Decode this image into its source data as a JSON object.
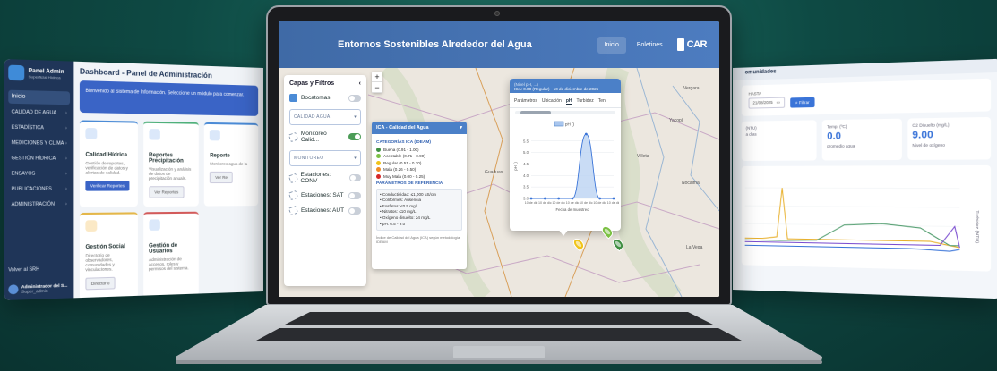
{
  "left_panel": {
    "brand_title": "Panel Admin",
    "brand_sub": "Superficial Hídrica",
    "nav_active": "Inicio",
    "nav_items": [
      "CALIDAD DE AGUA",
      "ESTADÍSTICA",
      "MEDICIONES Y CLIMA",
      "GESTIÓN HÍDRICA",
      "ENSAYOS",
      "PUBLICACIONES",
      "ADMINISTRACIÓN"
    ],
    "back_label": "Volver al SRH",
    "user_name": "Administrador del S...",
    "user_role": "Super_admin",
    "title": "Dashboard - Panel de Administración",
    "welcome": "Bienvenido al Sistema de Información. Seleccione un módulo para comenzar.",
    "cards": [
      {
        "title": "Calidad Hídrica",
        "desc": "Gestión de reportes, verificación de datos y alertas de calidad.",
        "button": "Verificar Reportes"
      },
      {
        "title": "Reportes Precipitación",
        "desc": "Visualización y análisis de datos de precipitación anuals.",
        "button": "Ver Reportes"
      },
      {
        "title": "Reporte",
        "desc": "Monitoreo agua de la",
        "button": "Ver Re"
      },
      {
        "title": "Gestión Social",
        "desc": "Directorio de observadores, comunidades y vinculaciones.",
        "button": "Directorio"
      },
      {
        "title": "Gestión de Usuarios",
        "desc": "Administración de accesos, roles y permisos del sistema.",
        "button": ""
      }
    ]
  },
  "laptop": {
    "app_title": "Entornos Sostenibles Alrededor del Agua",
    "nav": [
      "Inicio",
      "Boletines"
    ],
    "logo_text": "CAR",
    "layers": {
      "title": "Capas y Filtros",
      "bocatomas": "Bocatomas",
      "group_calidad": "CALIDAD AGUA",
      "monitoreo": "Monitoreo Calid...",
      "group_monitoreo": "MONITOREO",
      "est_conv": "Estaciones: CONV",
      "est_sat": "Estaciones: SAT",
      "est_aut": "Estaciones: AUT"
    },
    "ica": {
      "title": "ICA - Calidad del Agua",
      "cat_title": "CATEGORÍAS ICA (IDEAM)",
      "categories": [
        {
          "label": "Buena (0.91 - 1.00)",
          "color": "#3e8e41"
        },
        {
          "label": "Aceptable (0.71 - 0.90)",
          "color": "#7bc043"
        },
        {
          "label": "Regular (0.51 - 0.70)",
          "color": "#f0c419"
        },
        {
          "label": "Mala (0.26 - 0.50)",
          "color": "#f08c24"
        },
        {
          "label": "Muy Mala (0.00 - 0.25)",
          "color": "#d62828"
        }
      ],
      "ref_title": "PARÁMETROS DE REFERENCIA",
      "refs": [
        "• Conductividad: ≤1,000 µS/cm",
        "• Coliformes: Ausencia",
        "• Fosfatos: ≤0.5 mg/L",
        "• Nitratos: ≤10 mg/L",
        "• Oxígeno disuelto: ≥4 mg/L",
        "• pH: 6.5 - 9.0"
      ],
      "footer": "Índice de Calidad del Agua (ICA) según metodología IDEAM"
    },
    "popup": {
      "header_line1": "(Nivel pH, ...)",
      "header_line2": "ICA: 0.00 (Regular) - 10 de diciembre de 2025",
      "tabs": [
        "Parámetros",
        "Ubicación",
        "pH",
        "Turbidez",
        "Ten"
      ],
      "active_tab": "pH"
    }
  },
  "right_panel": {
    "header": "omunidades",
    "date_label": "HASTA",
    "date_value": "21/08/2025",
    "filter_button": "Filtrar",
    "stats": [
      {
        "label": "(NTU)",
        "value": "",
        "sub": "a días"
      },
      {
        "label": "Temp. (ºC)",
        "value": "0.0",
        "sub": "promedio agua"
      },
      {
        "label": "O2 Disuelto (mg/L)",
        "value": "9.00",
        "sub": "Nivel de oxígeno"
      }
    ],
    "y_axis_label": "Turbidez (NTU)"
  },
  "chart_data": {
    "type": "line",
    "title": "",
    "legend": [
      "pH ()"
    ],
    "x": [
      "10 de dic",
      "10 de dic",
      "10 de dic",
      "10 de dic",
      "10 de dic",
      "10 de dic",
      "10 de dic"
    ],
    "series": [
      {
        "name": "pH ()",
        "values": [
          3.0,
          3.0,
          3.0,
          3.0,
          5.8,
          3.0,
          3.0
        ]
      }
    ],
    "xlabel": "Fecha de muestreo",
    "ylabel": "pH ()",
    "yticks": [
      "3.0",
      "3.5",
      "4.0",
      "4.5",
      "5.0",
      "5.5"
    ],
    "ylim": [
      3.0,
      5.8
    ]
  }
}
